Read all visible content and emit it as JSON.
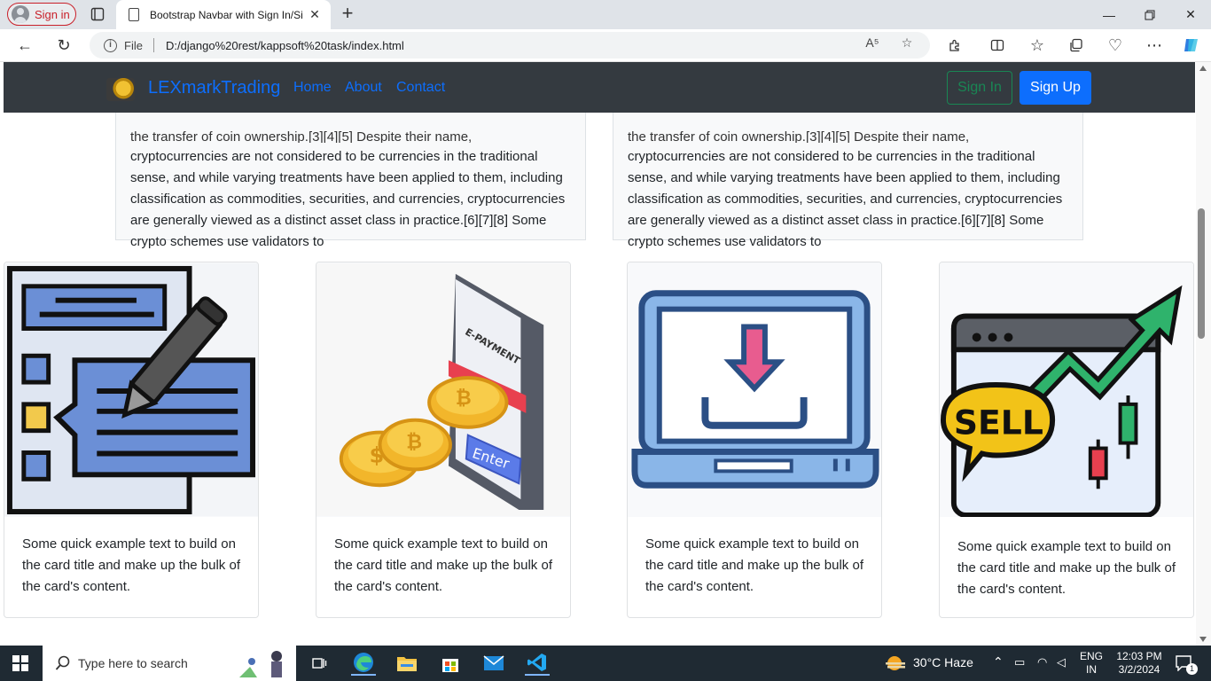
{
  "browser": {
    "profile_label": "Sign in",
    "tab_title": "Bootstrap Navbar with Sign In/Si",
    "new_tab": "+",
    "address_scheme": "File",
    "address_url": "D:/django%20rest/kappsoft%20task/index.html",
    "read_aloud": "A⁵"
  },
  "navbar": {
    "brand": "LEXmarkTrading",
    "links": [
      "Home",
      "About",
      "Contact"
    ],
    "sign_in": "Sign In",
    "sign_up": "Sign Up"
  },
  "text_boxes": [
    {
      "clipped_line": "the transfer of coin ownership.[3][4][5] Despite their name,",
      "body": "cryptocurrencies are not considered to be currencies in the traditional sense, and while varying treatments have been applied to them, including classification as commodities, securities, and currencies, cryptocurrencies are generally viewed as a distinct asset class in practice.[6][7][8] Some crypto schemes use validators to"
    },
    {
      "clipped_line": "the transfer of coin ownership.[3][4][5] Despite their name,",
      "body": "cryptocurrencies are not considered to be currencies in the traditional sense, and while varying treatments have been applied to them, including classification as commodities, securities, and currencies, cryptocurrencies are generally viewed as a distinct asset class in practice.[6][7][8] Some crypto schemes use validators to"
    }
  ],
  "cards": [
    {
      "image": "document-edit-icon",
      "text": "Some quick example text to build on the card title and make up the bulk of the card's content."
    },
    {
      "image": "e-payment-coins-icon",
      "image_text": [
        "E-PAYMENT",
        "Enter"
      ],
      "text": "Some quick example text to build on the card title and make up the bulk of the card's content."
    },
    {
      "image": "laptop-download-icon",
      "text": "Some quick example text to build on the card title and make up the bulk of the card's content."
    },
    {
      "image": "sell-chart-icon",
      "image_text": [
        "SELL"
      ],
      "text": "Some quick example text to build on the card title and make up the bulk of the card's content."
    }
  ],
  "taskbar": {
    "search_placeholder": "Type here to search",
    "weather": "30°C  Haze",
    "lang_top": "ENG",
    "lang_bottom": "IN",
    "time": "12:03 PM",
    "date": "3/2/2024",
    "notifications": "1"
  },
  "colors": {
    "navbar_bg": "#343a40",
    "primary": "#0d6efd",
    "success": "#198754",
    "profile_red": "#c9202a"
  }
}
